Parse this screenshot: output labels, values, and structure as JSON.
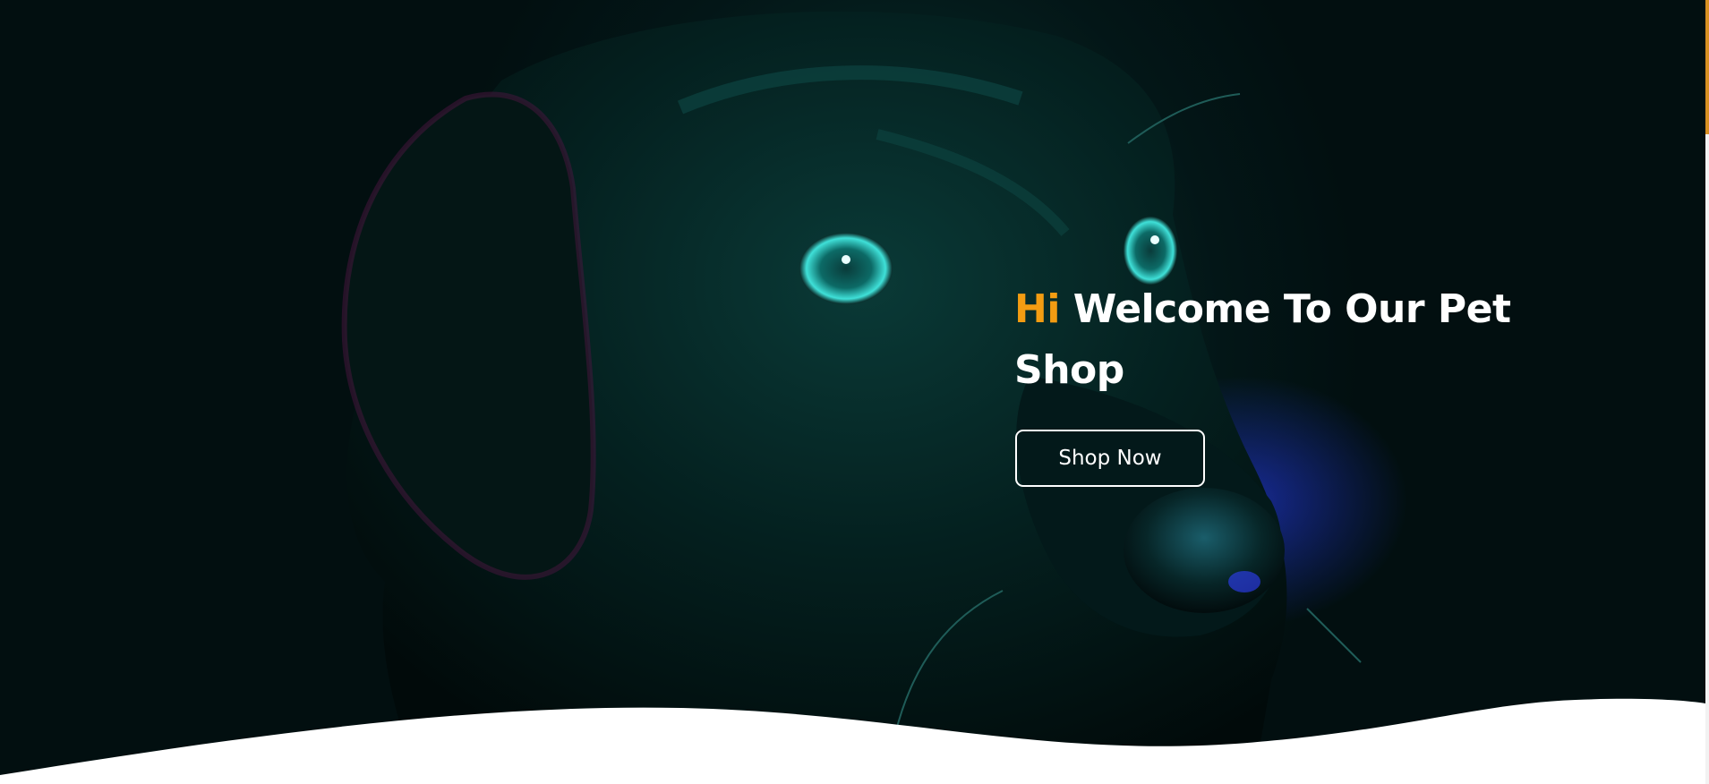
{
  "hero": {
    "headline_accent": "Hi",
    "headline_rest": " Welcome To Our Pet Shop",
    "cta_label": "Shop Now",
    "image_icon": "dog-portrait-icon"
  },
  "colors": {
    "accent": "#f39c12",
    "text": "#ffffff",
    "background": "#031617",
    "scrollbar_thumb": "#d89022"
  }
}
